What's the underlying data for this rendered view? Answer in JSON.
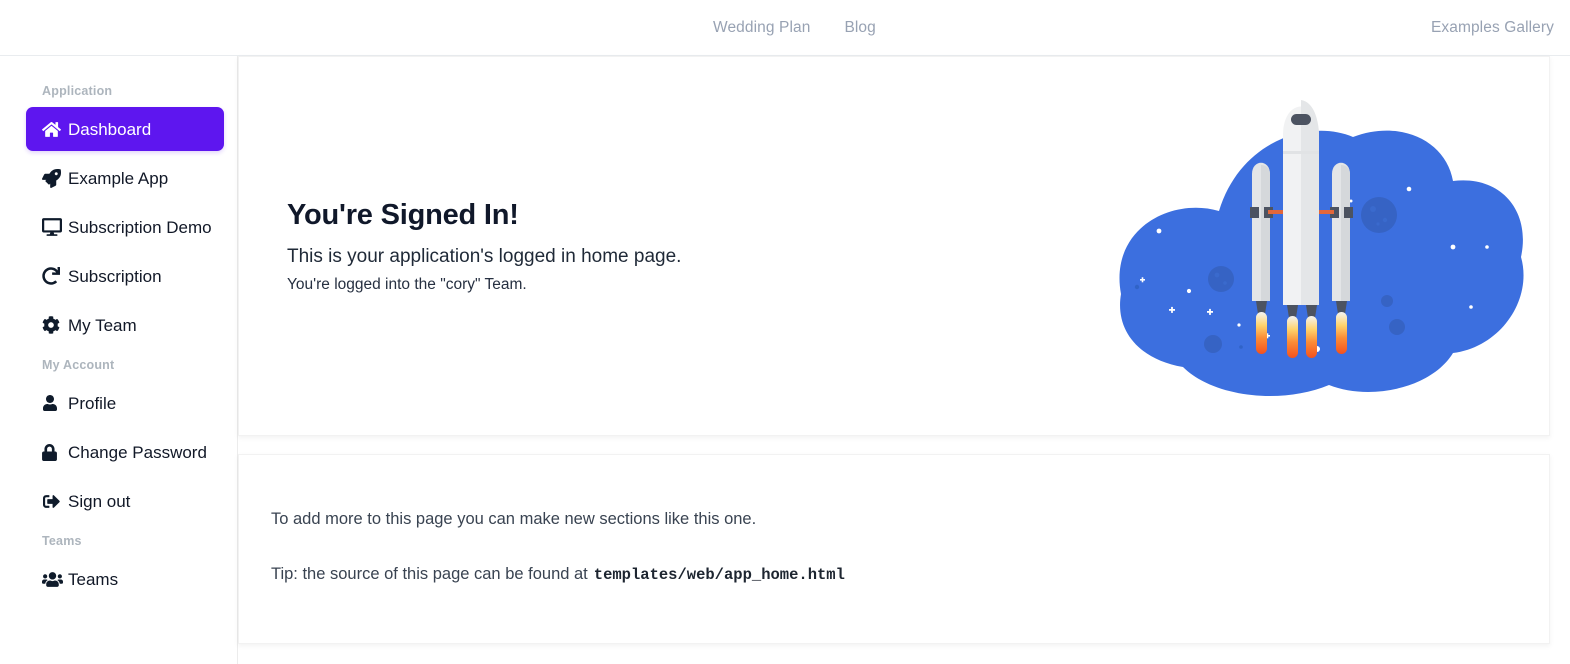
{
  "navbar": {
    "center_links": [
      {
        "label": "Wedding Plan",
        "name": "nav-link-wedding-plan"
      },
      {
        "label": "Blog",
        "name": "nav-link-blog"
      }
    ],
    "right_link": {
      "label": "Examples Gallery",
      "name": "nav-link-examples-gallery"
    }
  },
  "sidebar": {
    "groups": [
      {
        "heading": "Application",
        "items": [
          {
            "label": "Dashboard",
            "icon": "home-icon",
            "active": true
          },
          {
            "label": "Example App",
            "icon": "rocket-icon",
            "active": false
          },
          {
            "label": "Subscription Demo",
            "icon": "desktop-icon",
            "active": false
          },
          {
            "label": "Subscription",
            "icon": "redo-icon",
            "active": false
          },
          {
            "label": "My Team",
            "icon": "gear-icon",
            "active": false
          }
        ]
      },
      {
        "heading": "My Account",
        "items": [
          {
            "label": "Profile",
            "icon": "user-icon",
            "active": false
          },
          {
            "label": "Change Password",
            "icon": "lock-icon",
            "active": false
          },
          {
            "label": "Sign out",
            "icon": "sign-out-icon",
            "active": false
          }
        ]
      },
      {
        "heading": "Teams",
        "items": [
          {
            "label": "Teams",
            "icon": "users-group-icon",
            "active": false
          }
        ]
      }
    ]
  },
  "hero": {
    "title": "You're Signed In!",
    "lead": "This is your application's logged in home page.",
    "sub": "You're logged into the \"cory\" Team.",
    "illustration": "rocket-launch-illustration"
  },
  "info": {
    "line1": "To add more to this page you can make new sections like this one.",
    "line2_prefix": "Tip: the source of this page can be found at",
    "line2_path": "templates/web/app_home.html"
  },
  "colors": {
    "accent_purple": "#5e16ef",
    "nav_link": "#98a2b3",
    "illustration_blue": "#3c6fdf",
    "flame_orange": "#f4511e",
    "rocket_body": "#eceef0"
  }
}
